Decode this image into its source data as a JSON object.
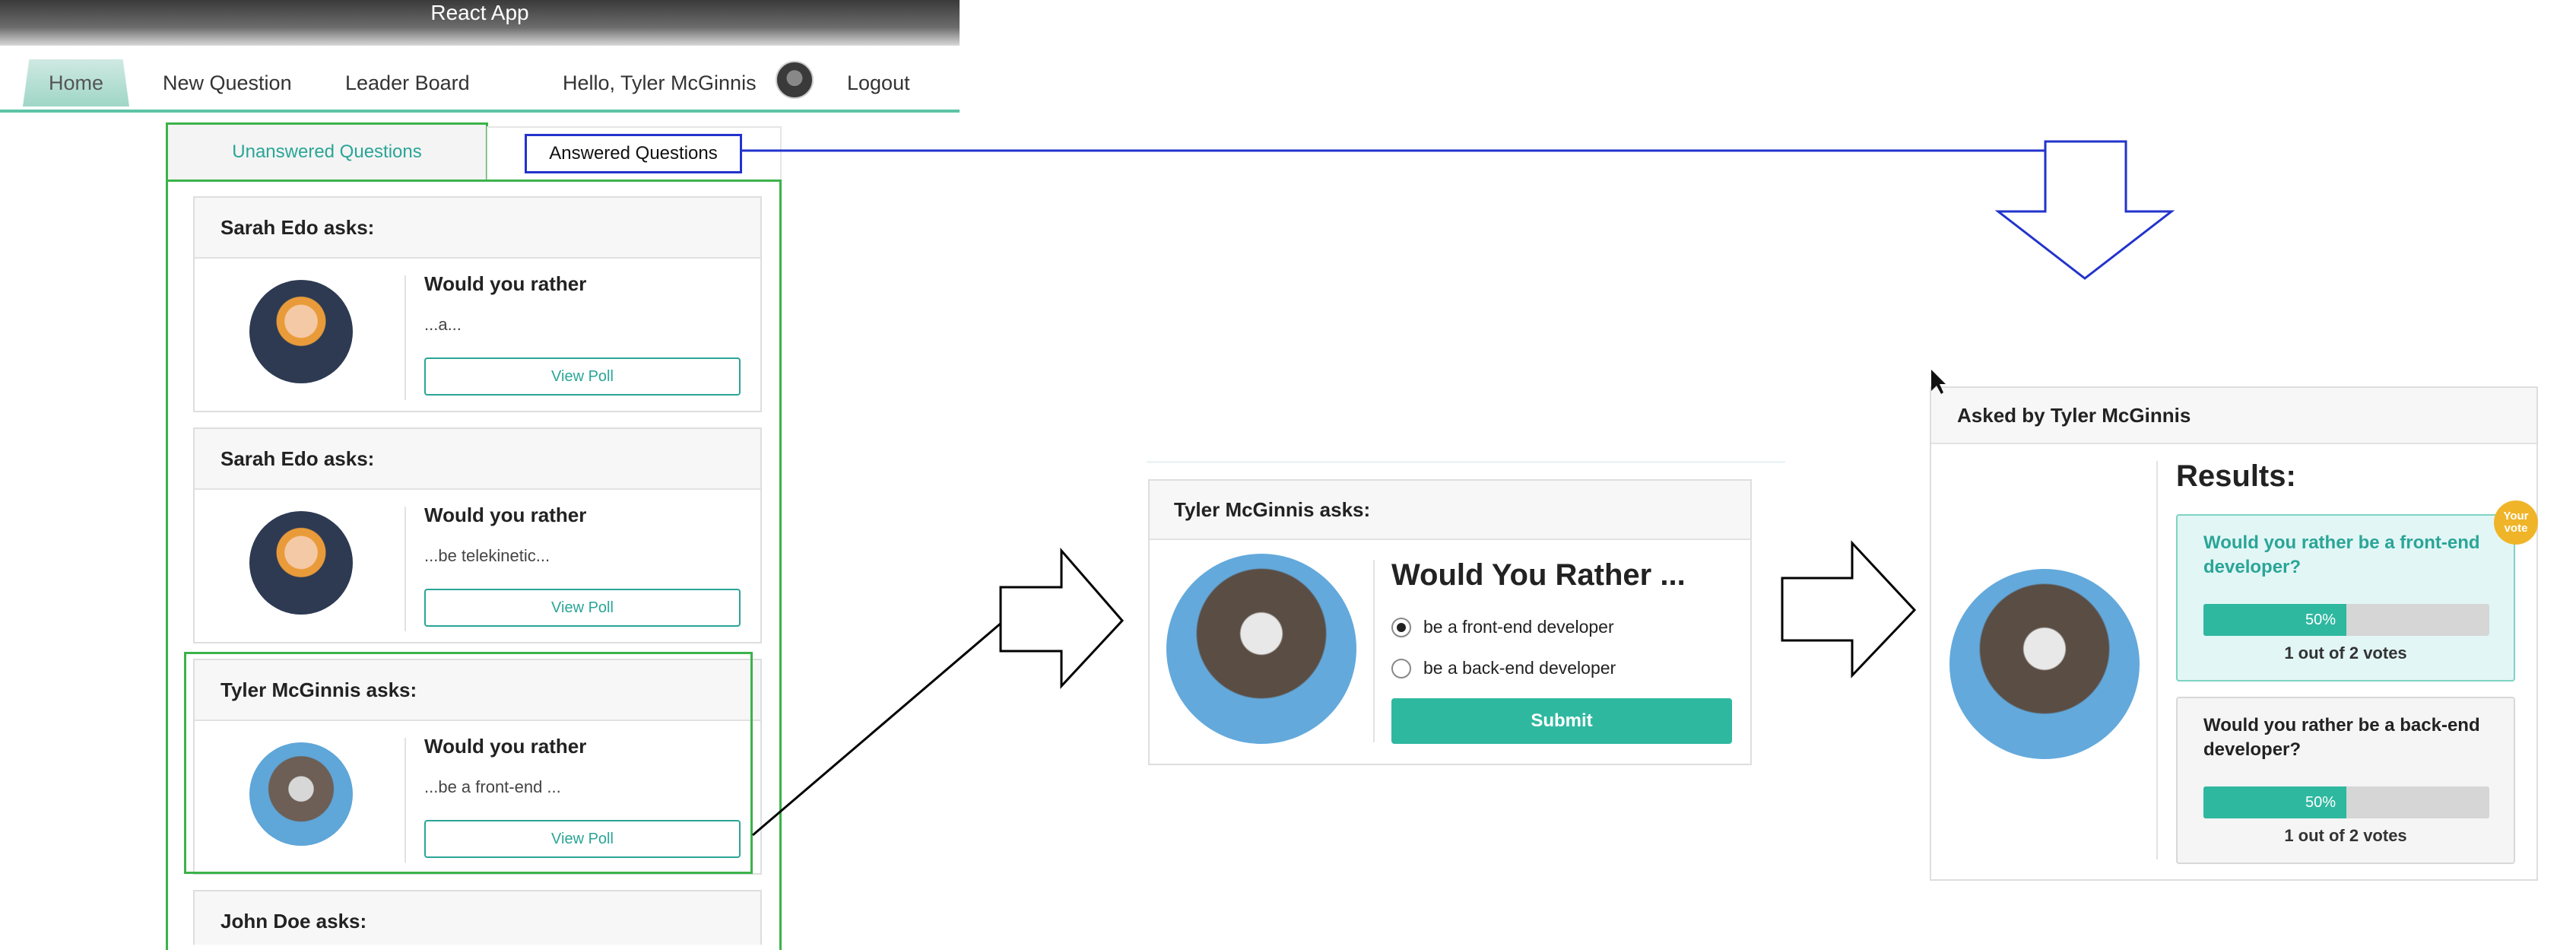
{
  "window": {
    "title": "React App"
  },
  "nav": {
    "items": [
      "Home",
      "New Question",
      "Leader Board"
    ],
    "greeting": "Hello, Tyler McGinnis",
    "logout": "Logout"
  },
  "tabs": {
    "unanswered": "Unanswered Questions",
    "answered": "Answered Questions"
  },
  "questions": [
    {
      "asker": "Sarah Edo asks:",
      "prompt": "Would you rather",
      "teaser": "...a...",
      "button": "View Poll"
    },
    {
      "asker": "Sarah Edo asks:",
      "prompt": "Would you rather",
      "teaser": "...be telekinetic...",
      "button": "View Poll"
    },
    {
      "asker": "Tyler McGinnis asks:",
      "prompt": "Would you rather",
      "teaser": "...be a front-end ...",
      "button": "View Poll"
    },
    {
      "asker": "John Doe asks:"
    }
  ],
  "poll": {
    "asker": "Tyler McGinnis asks:",
    "title": "Would You Rather ...",
    "options": [
      "be a front-end developer",
      "be a back-end developer"
    ],
    "selected_index": 0,
    "submit": "Submit"
  },
  "results": {
    "asked_by": "Asked by Tyler McGinnis",
    "title": "Results:",
    "badge": "Your vote",
    "options": [
      {
        "text": "Would you rather be a front-end developer?",
        "percent": 50,
        "percent_label": "50%",
        "votes": "1 out of 2 votes",
        "voted": true
      },
      {
        "text": "Would you rather be a back-end developer?",
        "percent": 50,
        "percent_label": "50%",
        "votes": "1 out of 2 votes",
        "voted": false
      }
    ]
  },
  "colors": {
    "accent": "#2fb8a0",
    "highlight_green": "#3bb34a",
    "annotation_blue": "#2233cc",
    "badge": "#f0b429"
  }
}
